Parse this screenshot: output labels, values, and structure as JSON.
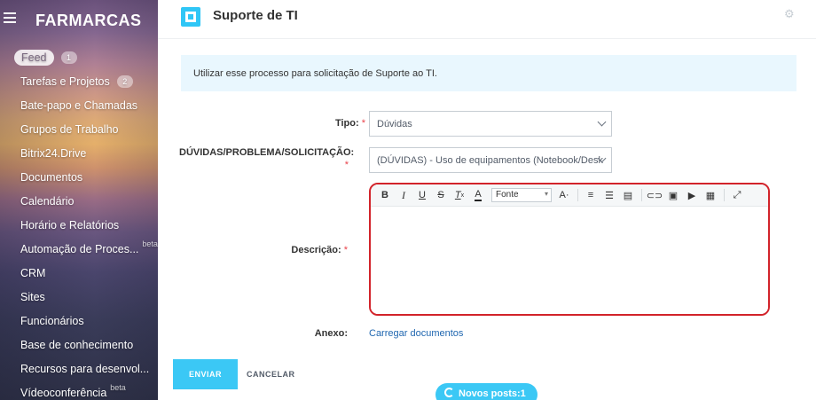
{
  "sidebar": {
    "logo": "FARMARCAS",
    "items": [
      {
        "label": "Feed",
        "counter": "1"
      },
      {
        "label": "Tarefas e Projetos",
        "counter": "2"
      },
      {
        "label": "Bate-papo e Chamadas"
      },
      {
        "label": "Grupos de Trabalho"
      },
      {
        "label": "Bitrix24.Drive"
      },
      {
        "label": "Documentos"
      },
      {
        "label": "Calendário"
      },
      {
        "label": "Horário e Relatórios"
      },
      {
        "label": "Automação de Proces...",
        "badge": "beta"
      },
      {
        "label": "CRM"
      },
      {
        "label": "Sites"
      },
      {
        "label": "Funcionários"
      },
      {
        "label": "Base de conhecimento"
      },
      {
        "label": "Recursos para desenvol..."
      },
      {
        "label": "Vídeoconferência",
        "badge": "beta"
      }
    ]
  },
  "header": {
    "title": "Suporte de TI"
  },
  "info": {
    "text": "Utilizar esse processo para solicitação de Suporte ao TI."
  },
  "form": {
    "tipo": {
      "label": "Tipo:",
      "value": "Dúvidas"
    },
    "duvidas": {
      "label": "DÚVIDAS/PROBLEMA/SOLICITAÇÃO:",
      "value": "(DÚVIDAS) - Uso de equipamentos (Notebook/Desk"
    },
    "descricao": {
      "label": "Descrição:"
    },
    "anexo": {
      "label": "Anexo:",
      "link": "Carregar documentos"
    },
    "required_mark": "*"
  },
  "editor": {
    "font_select": "Fonte",
    "tools": [
      "bold-icon",
      "italic-icon",
      "underline-icon",
      "strikethrough-icon",
      "clear-format-icon",
      "font-color-icon",
      "font-size-icon",
      "ordered-list-icon",
      "unordered-list-icon",
      "align-icon",
      "link-icon",
      "image-icon",
      "video-icon",
      "table-icon",
      "fullscreen-icon"
    ]
  },
  "actions": {
    "send": "ENVIAR",
    "cancel": "CANCELAR"
  },
  "notification": {
    "new_posts": "Novos posts:1"
  },
  "colors": {
    "accent": "#3bc8f5",
    "highlight_border": "#d2232a",
    "info_bg": "#e9f7fe"
  }
}
